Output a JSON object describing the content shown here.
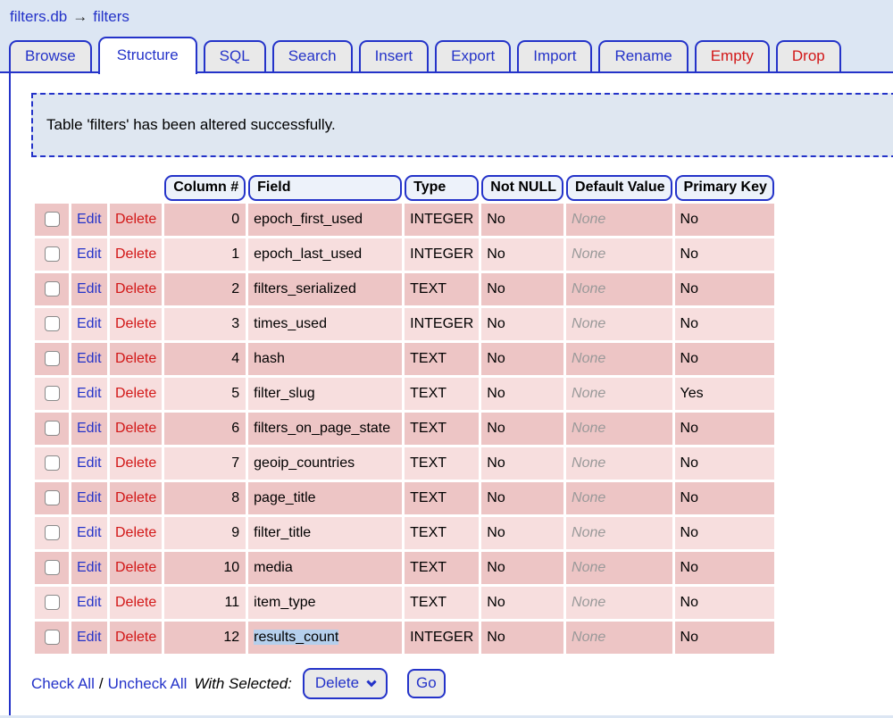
{
  "breadcrumb": {
    "db_label": "filters.db",
    "arrow": "→",
    "table_label": "filters"
  },
  "tabs": [
    {
      "label": "Browse",
      "color": "blue",
      "active": false
    },
    {
      "label": "Structure",
      "color": "blue",
      "active": true
    },
    {
      "label": "SQL",
      "color": "blue",
      "active": false
    },
    {
      "label": "Search",
      "color": "blue",
      "active": false
    },
    {
      "label": "Insert",
      "color": "blue",
      "active": false
    },
    {
      "label": "Export",
      "color": "blue",
      "active": false
    },
    {
      "label": "Import",
      "color": "blue",
      "active": false
    },
    {
      "label": "Rename",
      "color": "blue",
      "active": false
    },
    {
      "label": "Empty",
      "color": "red",
      "active": false
    },
    {
      "label": "Drop",
      "color": "red",
      "active": false
    }
  ],
  "message": "Table 'filters' has been altered successfully.",
  "table": {
    "headers": [
      "Column #",
      "Field",
      "Type",
      "Not NULL",
      "Default Value",
      "Primary Key"
    ],
    "actions": {
      "edit": "Edit",
      "delete": "Delete"
    },
    "rows": [
      {
        "column": "0",
        "field": "epoch_first_used",
        "type": "INTEGER",
        "not_null": "No",
        "default": "None",
        "primary_key": "No",
        "field_selected": false
      },
      {
        "column": "1",
        "field": "epoch_last_used",
        "type": "INTEGER",
        "not_null": "No",
        "default": "None",
        "primary_key": "No",
        "field_selected": false
      },
      {
        "column": "2",
        "field": "filters_serialized",
        "type": "TEXT",
        "not_null": "No",
        "default": "None",
        "primary_key": "No",
        "field_selected": false
      },
      {
        "column": "3",
        "field": "times_used",
        "type": "INTEGER",
        "not_null": "No",
        "default": "None",
        "primary_key": "No",
        "field_selected": false
      },
      {
        "column": "4",
        "field": "hash",
        "type": "TEXT",
        "not_null": "No",
        "default": "None",
        "primary_key": "No",
        "field_selected": false
      },
      {
        "column": "5",
        "field": "filter_slug",
        "type": "TEXT",
        "not_null": "No",
        "default": "None",
        "primary_key": "Yes",
        "field_selected": false
      },
      {
        "column": "6",
        "field": "filters_on_page_state",
        "type": "TEXT",
        "not_null": "No",
        "default": "None",
        "primary_key": "No",
        "field_selected": false
      },
      {
        "column": "7",
        "field": "geoip_countries",
        "type": "TEXT",
        "not_null": "No",
        "default": "None",
        "primary_key": "No",
        "field_selected": false
      },
      {
        "column": "8",
        "field": "page_title",
        "type": "TEXT",
        "not_null": "No",
        "default": "None",
        "primary_key": "No",
        "field_selected": false
      },
      {
        "column": "9",
        "field": "filter_title",
        "type": "TEXT",
        "not_null": "No",
        "default": "None",
        "primary_key": "No",
        "field_selected": false
      },
      {
        "column": "10",
        "field": "media",
        "type": "TEXT",
        "not_null": "No",
        "default": "None",
        "primary_key": "No",
        "field_selected": false
      },
      {
        "column": "11",
        "field": "item_type",
        "type": "TEXT",
        "not_null": "No",
        "default": "None",
        "primary_key": "No",
        "field_selected": false
      },
      {
        "column": "12",
        "field": "results_count",
        "type": "INTEGER",
        "not_null": "No",
        "default": "None",
        "primary_key": "No",
        "field_selected": true
      }
    ]
  },
  "footer": {
    "check_all": "Check All",
    "separator": "/",
    "uncheck_all": "Uncheck All",
    "with_selected": "With Selected:",
    "action_option": "Delete",
    "go": "Go"
  },
  "colors": {
    "page_background": "#dce6f3",
    "accent_blue": "#2433c9",
    "accent_red": "#d21717",
    "row_dark": "#edc5c5",
    "row_light": "#f7dede",
    "message_background": "#dfe7f1",
    "header_pill_background": "#edf2fa",
    "tab_background": "#e9e9e9",
    "selection_highlight": "#b5cfec",
    "none_text": "#999999"
  }
}
